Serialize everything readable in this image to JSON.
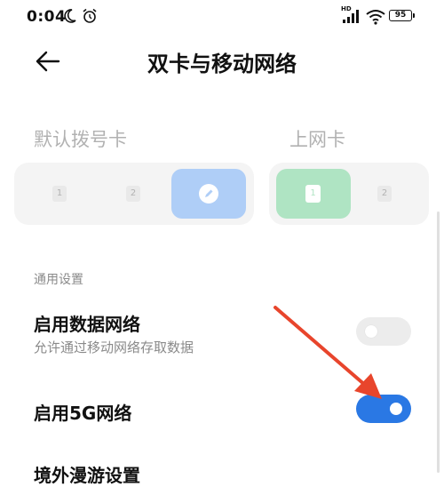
{
  "status_bar": {
    "time": "0:04",
    "network_badge": "HD",
    "battery": "95",
    "icons": [
      "moon-icon",
      "alarm-icon",
      "signal-icon",
      "wifi-icon",
      "battery-icon"
    ]
  },
  "header": {
    "title": "双卡与移动网络",
    "back_icon": "arrow-left-icon"
  },
  "sim_cards": {
    "default_dial": {
      "heading": "默认拨号卡",
      "options": [
        "1",
        "2"
      ],
      "selected": "edit"
    },
    "data_card": {
      "heading": "上网卡",
      "selected": "1",
      "other": "2"
    }
  },
  "general": {
    "section_label": "通用设置",
    "enable_data": {
      "title": "启用数据网络",
      "subtitle": "允许通过移动网络存取数据",
      "enabled": false
    },
    "enable_5g": {
      "title": "启用5G网络",
      "enabled": true
    },
    "roaming": {
      "title": "境外漫游设置"
    }
  },
  "colors": {
    "accent": "#2a78e4",
    "annotation_arrow": "#e8452c"
  }
}
